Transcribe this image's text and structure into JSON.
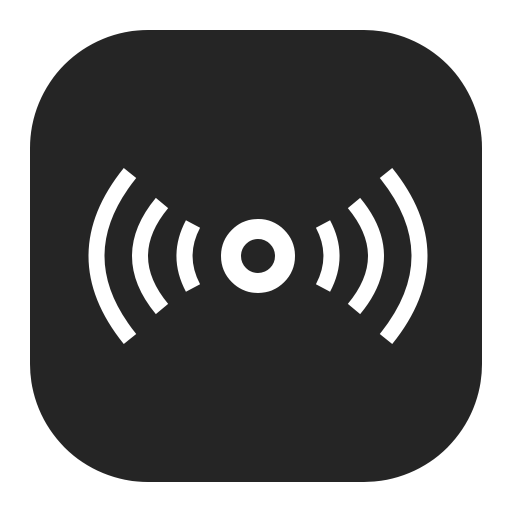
{
  "icon": {
    "name": "broadcast-signal-icon",
    "background_color": "#252525",
    "glyph_color": "#ffffff"
  }
}
